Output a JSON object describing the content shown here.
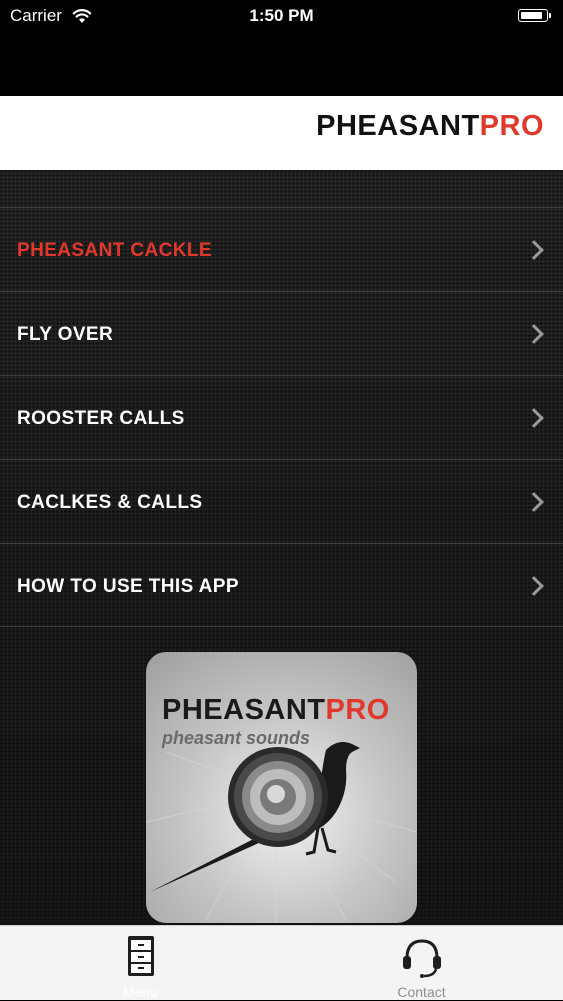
{
  "status_bar": {
    "carrier": "Carrier",
    "time": "1:50 PM"
  },
  "header": {
    "brand_part1": "PHEASANT",
    "brand_part2": "PRO"
  },
  "menu": {
    "items": [
      {
        "label": "PHEASANT CACKLE",
        "active": true
      },
      {
        "label": "FLY OVER",
        "active": false
      },
      {
        "label": "ROOSTER CALLS",
        "active": false
      },
      {
        "label": "CACLKES & CALLS",
        "active": false
      },
      {
        "label": "HOW TO USE THIS APP",
        "active": false
      }
    ]
  },
  "logo": {
    "title_part1": "PHEASANT",
    "title_part2": "PRO",
    "subtitle": "pheasant sounds"
  },
  "tab_bar": {
    "tabs": [
      {
        "label": "Menu",
        "icon": "cabinet-icon"
      },
      {
        "label": "Contact",
        "icon": "headset-icon"
      }
    ]
  },
  "colors": {
    "accent": "#e0392b",
    "background": "#000000",
    "tab_bar": "#f4f4f4"
  }
}
